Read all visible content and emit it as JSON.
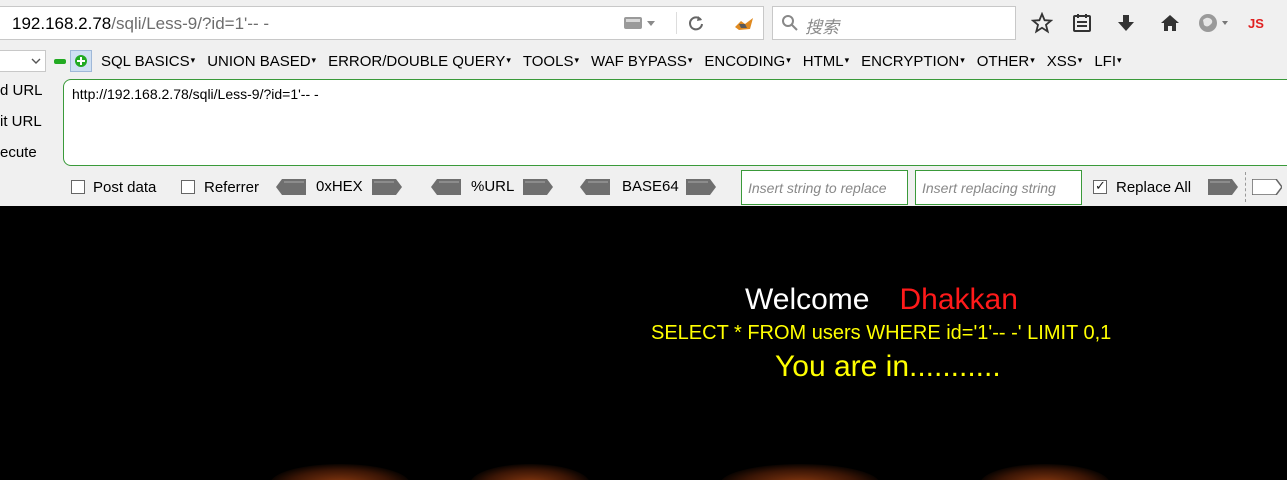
{
  "browser": {
    "url_host": "192.168.2.78",
    "url_path": "/sqli/Less-9/?id=1'-- -",
    "search_placeholder": "搜索",
    "js_label": "JS"
  },
  "hackbar": {
    "menu": [
      "SQL BASICS",
      "UNION BASED",
      "ERROR/DOUBLE QUERY",
      "TOOLS",
      "WAF BYPASS",
      "ENCODING",
      "HTML",
      "ENCRYPTION",
      "OTHER",
      "XSS",
      "LFI"
    ],
    "side": [
      "d URL",
      "it URL",
      "ecute"
    ],
    "textarea_value": "http://192.168.2.78/sqli/Less-9/?id=1'-- -",
    "post_data_label": "Post data",
    "referrer_label": "Referrer",
    "hex_label": "0xHEX",
    "url_label": "%URL",
    "base64_label": "BASE64",
    "replace_placeholder": "Insert string to replace",
    "replacing_placeholder": "Insert replacing string",
    "replace_all_label": "Replace All",
    "post_data_checked": false,
    "referrer_checked": false,
    "replace_all_checked": true
  },
  "page": {
    "welcome": "Welcome",
    "name": "Dhakkan",
    "query": "SELECT * FROM users WHERE id='1'-- -' LIMIT 0,1",
    "result": "You are in..........."
  },
  "colors": {
    "accent_green": "#3a9a3a",
    "name_red": "#ff1a1a",
    "text_yellow": "#ffff00"
  }
}
